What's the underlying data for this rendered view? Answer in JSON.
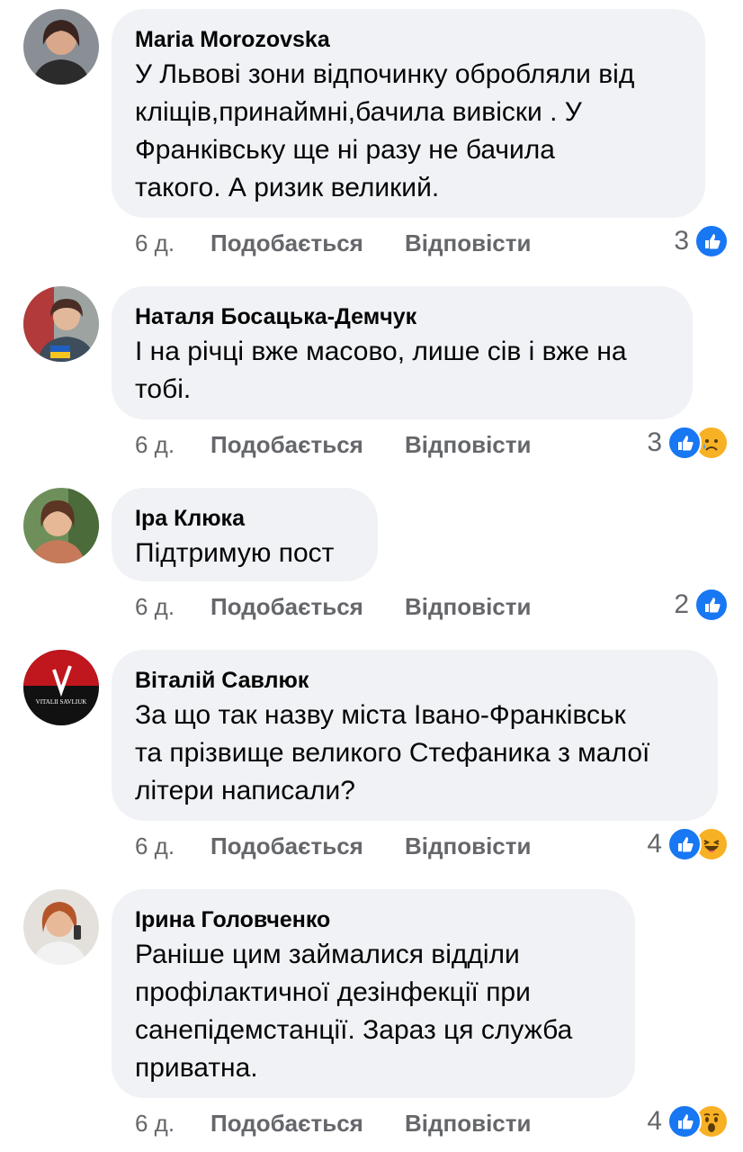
{
  "colors": {
    "bubble_bg": "#f0f2f5",
    "meta_text": "#65676b",
    "like_blue": "#1877f2",
    "emoji_yellow": "#f7b125"
  },
  "comments": [
    {
      "author": "Maria Morozovska",
      "lines": [
        "У Львові зони відпочинку обробляли від",
        "кліщів,принаймні,бачила вивіски . У",
        "Франківську ще ні разу не бачила",
        "такого. А ризик великий."
      ],
      "time": "6 д.",
      "like_label": "Подобається",
      "reply_label": "Відповісти",
      "reaction_count": "3",
      "reactions": [
        "like-icon"
      ]
    },
    {
      "author": "Наталя Босацька-Демчук",
      "lines": [
        "І на річці вже масово, лише сів і вже на",
        "тобі."
      ],
      "time": "6 д.",
      "like_label": "Подобається",
      "reply_label": "Відповісти",
      "reaction_count": "3",
      "reactions": [
        "like-icon",
        "sad-emoji-icon"
      ]
    },
    {
      "author": "Іра Клюка",
      "lines": [
        "Підтримую пост"
      ],
      "time": "6 д.",
      "like_label": "Подобається",
      "reply_label": "Відповісти",
      "reaction_count": "2",
      "reactions": [
        "like-icon"
      ]
    },
    {
      "author": "Віталій Савлюк",
      "lines": [
        "За що так назву міста Івано-Франківськ",
        "та прізвище великого Стефаника з малої",
        "літери написали?"
      ],
      "time": "6 д.",
      "like_label": "Подобається",
      "reply_label": "Відповісти",
      "reaction_count": "4",
      "reactions": [
        "like-icon",
        "haha-emoji-icon"
      ],
      "avatar_logo_text": "VITALII SAVLIUK"
    },
    {
      "author": "Ірина Головченко",
      "lines": [
        "Раніше цим займалися відділи",
        "профілактичної дезінфекції при",
        "санепідемстанції. Зараз ця служба",
        "приватна."
      ],
      "time": "6 д.",
      "like_label": "Подобається",
      "reply_label": "Відповісти",
      "reaction_count": "4",
      "reactions": [
        "like-icon",
        "wow-emoji-icon"
      ]
    }
  ]
}
